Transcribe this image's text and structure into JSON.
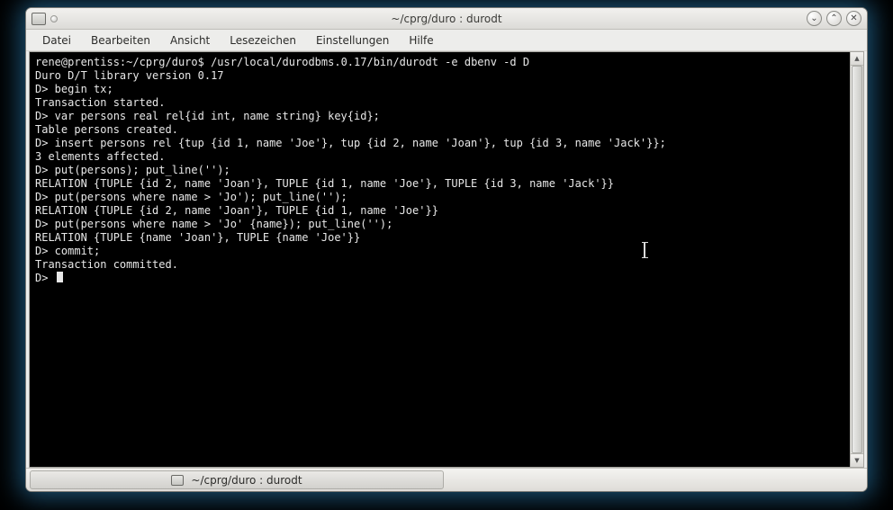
{
  "titlebar": {
    "title": "~/cprg/duro : durodt"
  },
  "window_controls": {
    "minimize": "⌄",
    "maximize": "⌃",
    "close": "✕"
  },
  "menu": {
    "file": "Datei",
    "edit": "Bearbeiten",
    "view": "Ansicht",
    "bookmarks": "Lesezeichen",
    "settings": "Einstellungen",
    "help": "Hilfe"
  },
  "session": {
    "prompt_user": "rene@prentiss",
    "prompt_path": "~/cprg/duro",
    "command": "/usr/local/durodbms.0.17/bin/durodt -e dbenv -d D",
    "lines": [
      "Duro D/T library version 0.17",
      "D> begin tx;",
      "Transaction started.",
      "D> var persons real rel{id int, name string} key{id};",
      "Table persons created.",
      "D> insert persons rel {tup {id 1, name 'Joe'}, tup {id 2, name 'Joan'}, tup {id 3, name 'Jack'}};",
      "3 elements affected.",
      "D> put(persons); put_line('');",
      "RELATION {TUPLE {id 2, name 'Joan'}, TUPLE {id 1, name 'Joe'}, TUPLE {id 3, name 'Jack'}}",
      "D> put(persons where name > 'Jo'); put_line('');",
      "RELATION {TUPLE {id 2, name 'Joan'}, TUPLE {id 1, name 'Joe'}}",
      "D> put(persons where name > 'Jo' {name}); put_line('');",
      "RELATION {TUPLE {name 'Joan'}, TUPLE {name 'Joe'}}",
      "D> commit;",
      "Transaction committed.",
      "D> "
    ]
  },
  "taskbar": {
    "item1": "~/cprg/duro : durodt"
  }
}
